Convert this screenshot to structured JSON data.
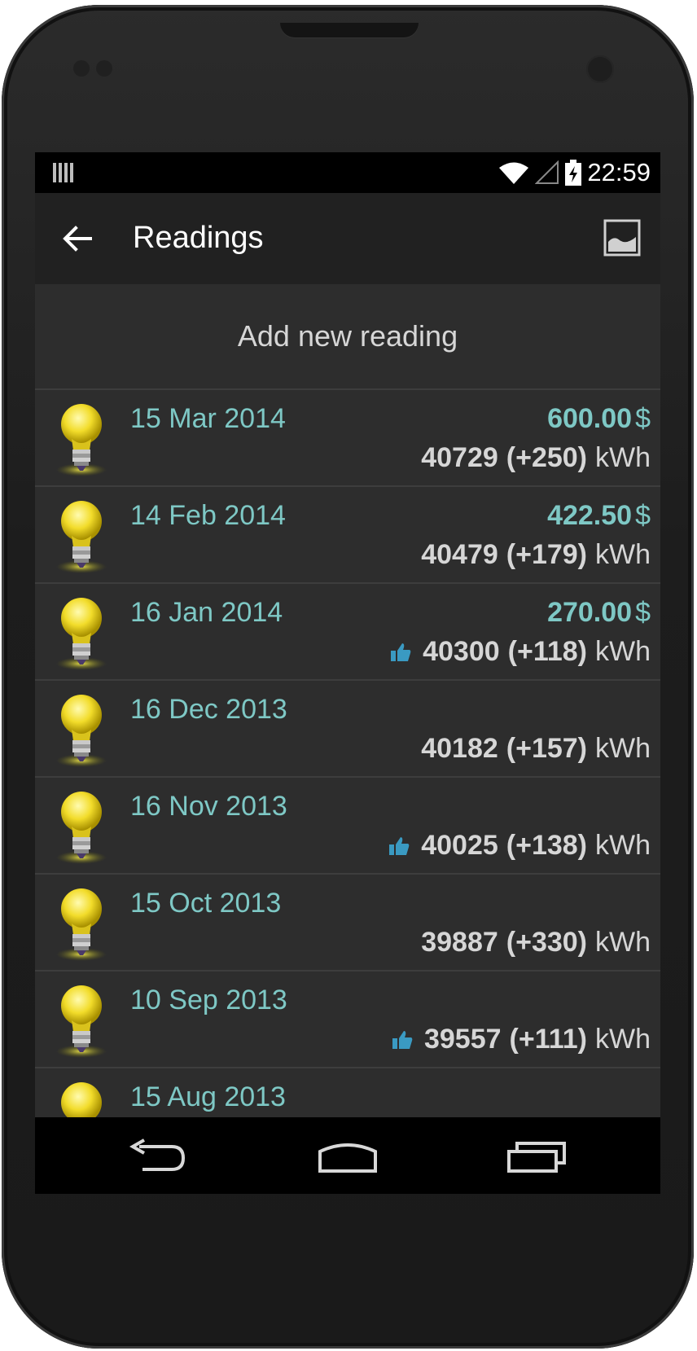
{
  "status_bar": {
    "time": "22:59",
    "icons": [
      "barcode-notification-icon",
      "wifi-icon",
      "signal-icon",
      "battery-charging-icon"
    ]
  },
  "app_bar": {
    "title": "Readings",
    "back_icon": "arrow-left-icon",
    "action_icon": "image-icon"
  },
  "add_reading": {
    "label": "Add new reading"
  },
  "readings": [
    {
      "date": "15 Mar 2014",
      "cost": "600.00",
      "currency": "$",
      "value": "40729",
      "delta": "(+250)",
      "unit": "kWh",
      "thumbs_up": false
    },
    {
      "date": "14 Feb 2014",
      "cost": "422.50",
      "currency": "$",
      "value": "40479",
      "delta": "(+179)",
      "unit": "kWh",
      "thumbs_up": false
    },
    {
      "date": "16 Jan 2014",
      "cost": "270.00",
      "currency": "$",
      "value": "40300",
      "delta": "(+118)",
      "unit": "kWh",
      "thumbs_up": true
    },
    {
      "date": "16 Dec 2013",
      "value": "40182",
      "delta": "(+157)",
      "unit": "kWh",
      "thumbs_up": false
    },
    {
      "date": "16 Nov 2013",
      "value": "40025",
      "delta": "(+138)",
      "unit": "kWh",
      "thumbs_up": true
    },
    {
      "date": "15 Oct 2013",
      "value": "39887",
      "delta": "(+330)",
      "unit": "kWh",
      "thumbs_up": false
    },
    {
      "date": "10 Sep 2013",
      "value": "39557",
      "delta": "(+111)",
      "unit": "kWh",
      "thumbs_up": true
    },
    {
      "date": "15 Aug 2013",
      "thumbs_up": false
    }
  ],
  "nav_bar": {
    "icons": [
      "back-nav-icon",
      "home-nav-icon",
      "recents-nav-icon"
    ]
  },
  "colors": {
    "accent": "#7ec8c5",
    "list_bg": "#2d2d2d",
    "appbar_bg": "#212121",
    "thumb": "#3a9ac2"
  }
}
